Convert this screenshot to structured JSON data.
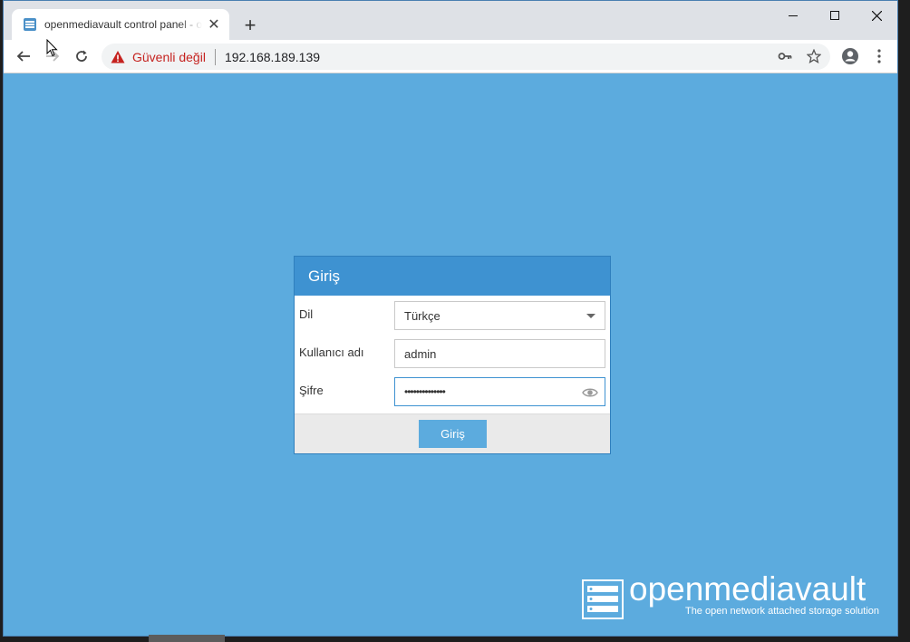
{
  "browser": {
    "tab_title": "openmediavault control panel - openmediavault",
    "new_tab_symbol": "+",
    "security_label": "Güvenli değil",
    "url": "192.168.189.139",
    "window_controls": [
      "minimize-icon",
      "maximize-icon",
      "close-icon"
    ]
  },
  "login": {
    "title": "Giriş",
    "language_label": "Dil",
    "language_value": "Türkçe",
    "username_label": "Kullanıcı adı",
    "username_value": "admin",
    "password_label": "Şifre",
    "password_value": "••••••••••••••",
    "submit_label": "Giriş"
  },
  "brand": {
    "name": "openmediavault",
    "tagline": "The open network attached storage solution"
  },
  "colors": {
    "page_background": "#5cabde",
    "dialog_header": "#3e92d1",
    "security_warning": "#c5221f"
  }
}
